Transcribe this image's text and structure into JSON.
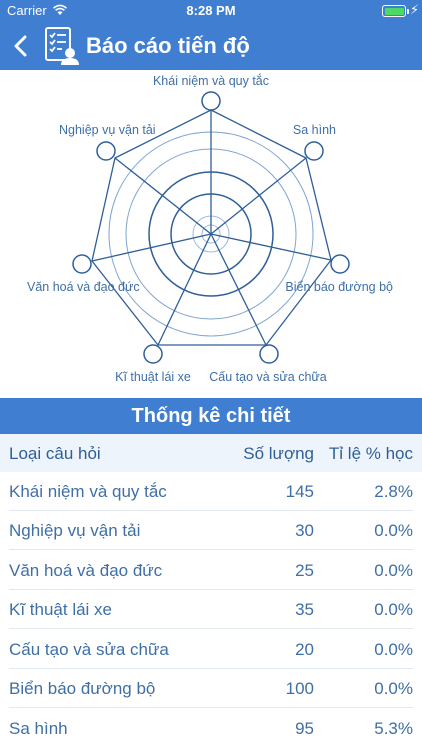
{
  "status_bar": {
    "carrier": "Carrier",
    "time": "8:28 PM"
  },
  "header": {
    "title": "Báo cáo tiến độ",
    "background": "#3F7ED0"
  },
  "radar": {
    "labels": [
      "Khái niệm và quy tắc",
      "Sa hình",
      "Biển báo đường bộ",
      "Cấu tạo và sửa chữa",
      "Kĩ thuật lái xe",
      "Văn hoá và đạo đức",
      "Nghiệp vụ vận tải"
    ]
  },
  "stats": {
    "title": "Thống kê chi tiết",
    "headers": {
      "type": "Loại câu hỏi",
      "count": "Số lượng",
      "rate": "Tỉ lệ % học"
    },
    "rows": [
      {
        "type": "Khái niệm và quy tắc",
        "count": "145",
        "rate": "2.8%"
      },
      {
        "type": "Nghiệp vụ vận tải",
        "count": "30",
        "rate": "0.0%"
      },
      {
        "type": "Văn hoá và đạo đức",
        "count": "25",
        "rate": "0.0%"
      },
      {
        "type": "Kĩ thuật lái xe",
        "count": "35",
        "rate": "0.0%"
      },
      {
        "type": "Cấu tạo và sửa chữa",
        "count": "20",
        "rate": "0.0%"
      },
      {
        "type": "Biển báo đường bộ",
        "count": "100",
        "rate": "0.0%"
      },
      {
        "type": "Sa hình",
        "count": "95",
        "rate": "5.3%"
      }
    ]
  }
}
